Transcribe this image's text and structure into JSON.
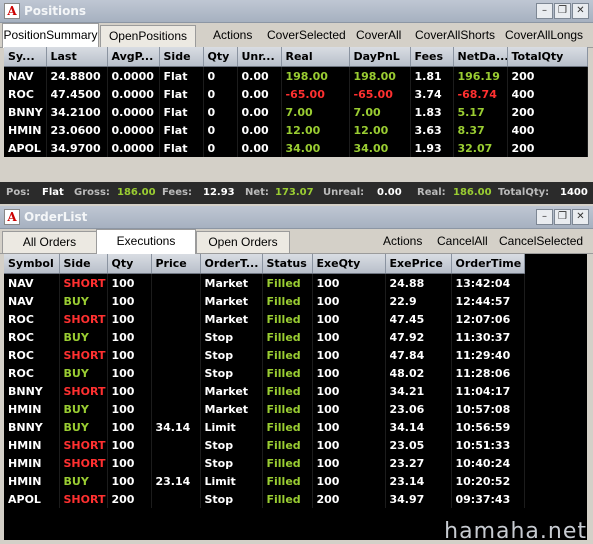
{
  "positions_window": {
    "title": "Positions",
    "tabs": [
      "PositionSummary",
      "OpenPositions"
    ],
    "actions": [
      "Actions",
      "CoverSelected",
      "CoverAll",
      "CoverAllShorts",
      "CoverAllLongs"
    ],
    "columns": [
      "Sy...",
      "Last",
      "AvgP...",
      "Side",
      "Qty",
      "Unr...",
      "Real",
      "DayPnL",
      "Fees",
      "NetDa...",
      "TotalQty"
    ],
    "rows": [
      [
        "NAV",
        "24.8800",
        "0.0000",
        "Flat",
        "0",
        "0.00",
        "198.00",
        "198.00",
        "1.81",
        "196.19",
        "200"
      ],
      [
        "ROC",
        "47.4500",
        "0.0000",
        "Flat",
        "0",
        "0.00",
        "-65.00",
        "-65.00",
        "3.74",
        "-68.74",
        "400"
      ],
      [
        "BNNY",
        "34.2100",
        "0.0000",
        "Flat",
        "0",
        "0.00",
        "7.00",
        "7.00",
        "1.83",
        "5.17",
        "200"
      ],
      [
        "HMIN",
        "23.0600",
        "0.0000",
        "Flat",
        "0",
        "0.00",
        "12.00",
        "12.00",
        "3.63",
        "8.37",
        "400"
      ],
      [
        "APOL",
        "34.9700",
        "0.0000",
        "Flat",
        "0",
        "0.00",
        "34.00",
        "34.00",
        "1.93",
        "32.07",
        "200"
      ]
    ],
    "status": {
      "pos_label": "Pos:",
      "pos": "Flat",
      "gross_label": "Gross:",
      "gross": "186.00",
      "fees_label": "Fees:",
      "fees": "12.93",
      "net_label": "Net:",
      "net": "173.07",
      "unreal_label": "Unreal:",
      "unreal": "0.00",
      "real_label": "Real:",
      "real": "186.00",
      "totalqty_label": "TotalQty:",
      "totalqty": "1400"
    }
  },
  "orderlist_window": {
    "title": "OrderList",
    "tabs": [
      "All Orders",
      "Executions",
      "Open Orders"
    ],
    "actions": [
      "Actions",
      "CancelAll",
      "CancelSelected"
    ],
    "columns": [
      "Symbol",
      "Side",
      "Qty",
      "Price",
      "OrderT...",
      "Status",
      "ExeQty",
      "ExePrice",
      "OrderTime"
    ],
    "rows": [
      [
        "NAV",
        "SHORT",
        "100",
        "",
        "Market",
        "Filled",
        "100",
        "24.88",
        "13:42:04"
      ],
      [
        "NAV",
        "BUY",
        "100",
        "",
        "Market",
        "Filled",
        "100",
        "22.9",
        "12:44:57"
      ],
      [
        "ROC",
        "SHORT",
        "100",
        "",
        "Market",
        "Filled",
        "100",
        "47.45",
        "12:07:06"
      ],
      [
        "ROC",
        "BUY",
        "100",
        "",
        "Stop",
        "Filled",
        "100",
        "47.92",
        "11:30:37"
      ],
      [
        "ROC",
        "SHORT",
        "100",
        "",
        "Stop",
        "Filled",
        "100",
        "47.84",
        "11:29:40"
      ],
      [
        "ROC",
        "BUY",
        "100",
        "",
        "Stop",
        "Filled",
        "100",
        "48.02",
        "11:28:06"
      ],
      [
        "BNNY",
        "SHORT",
        "100",
        "",
        "Market",
        "Filled",
        "100",
        "34.21",
        "11:04:17"
      ],
      [
        "HMIN",
        "BUY",
        "100",
        "",
        "Market",
        "Filled",
        "100",
        "23.06",
        "10:57:08"
      ],
      [
        "BNNY",
        "BUY",
        "100",
        "34.14",
        "Limit",
        "Filled",
        "100",
        "34.14",
        "10:56:59"
      ],
      [
        "HMIN",
        "SHORT",
        "100",
        "",
        "Stop",
        "Filled",
        "100",
        "23.05",
        "10:51:33"
      ],
      [
        "HMIN",
        "SHORT",
        "100",
        "",
        "Stop",
        "Filled",
        "100",
        "23.27",
        "10:40:24"
      ],
      [
        "HMIN",
        "BUY",
        "100",
        "23.14",
        "Limit",
        "Filled",
        "100",
        "23.14",
        "10:20:52"
      ],
      [
        "APOL",
        "SHORT",
        "200",
        "",
        "Stop",
        "Filled",
        "200",
        "34.97",
        "09:37:43"
      ]
    ]
  },
  "watermark": "hamaha.net",
  "colors": {
    "positive": "#9acd32",
    "negative": "#ff3030",
    "grid_bg": "#000000"
  }
}
